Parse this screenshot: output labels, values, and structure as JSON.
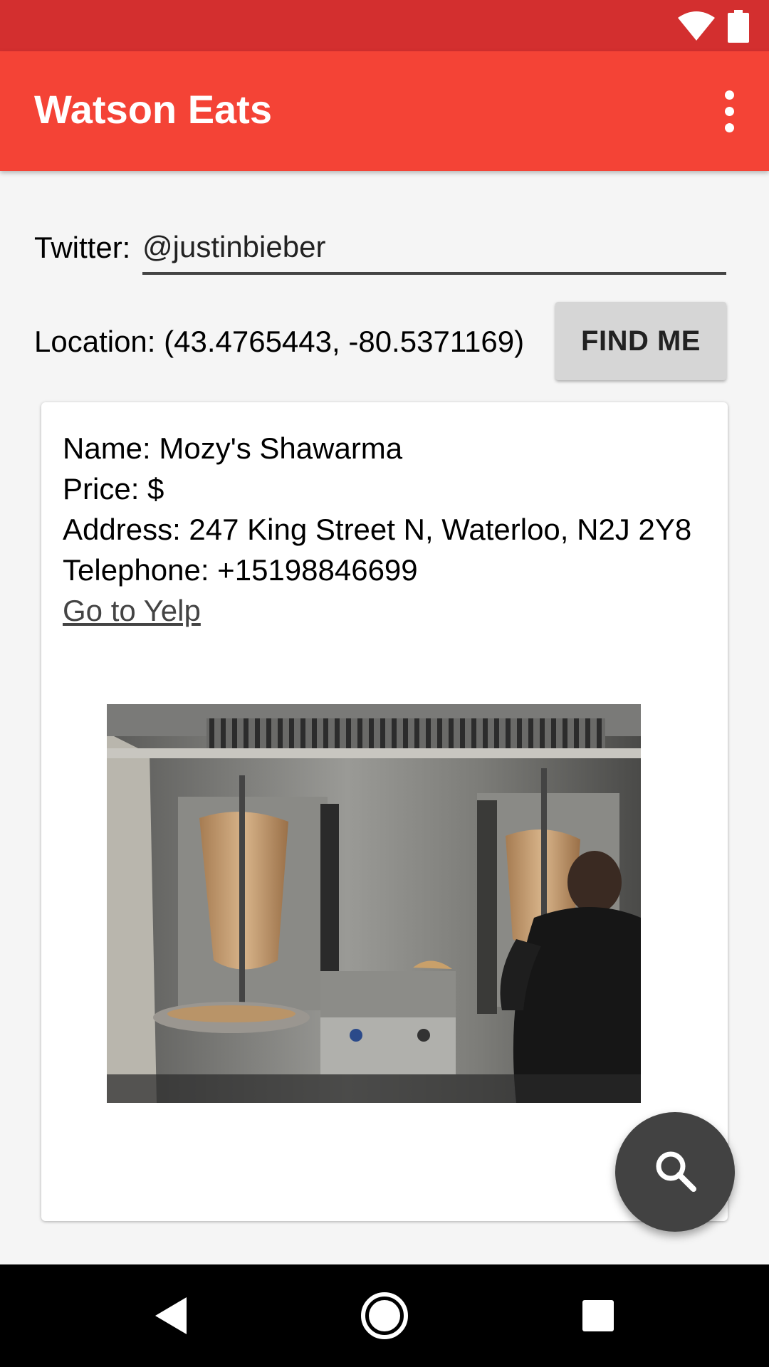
{
  "status_bar": {
    "icons": [
      "wifi-icon",
      "battery-icon"
    ],
    "color": "#d32f2f"
  },
  "app_bar": {
    "title": "Watson Eats",
    "color": "#f44336",
    "overflow_icon": "more-vert-icon"
  },
  "twitter": {
    "label": "Twitter:",
    "value": "@justinbieber"
  },
  "location": {
    "text": "Location: (43.4765443, -80.5371169)",
    "button_label": "FIND ME"
  },
  "restaurant": {
    "name_line": "Name: Mozy's Shawarma",
    "price_line": "Price: $",
    "address_line": "Address: 247 King Street N,  Waterloo, N2J 2Y8",
    "telephone_line": "Telephone: +15198846699",
    "yelp_link": "Go to Yelp ",
    "photo": "restaurant-photo"
  },
  "fab": {
    "icon": "search-icon",
    "color": "#424242"
  },
  "nav_bar": {
    "icons": [
      "back-icon",
      "home-icon",
      "recents-icon"
    ]
  }
}
